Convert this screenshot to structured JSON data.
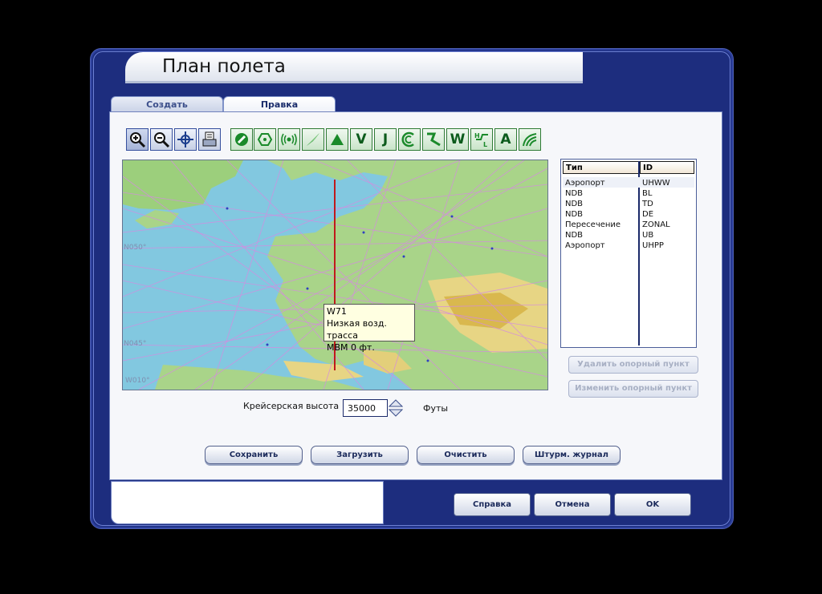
{
  "window": {
    "title": "План полета"
  },
  "tabs": [
    {
      "label": "Создать"
    },
    {
      "label": "Правка"
    }
  ],
  "toolbar": {
    "map_tools": [
      "zoom-in-icon",
      "zoom-out-icon",
      "center-icon",
      "print-icon"
    ],
    "filters": [
      {
        "icon": "airport-filter-icon",
        "label": ""
      },
      {
        "icon": "vor-filter-icon",
        "label": ""
      },
      {
        "icon": "ndb-filter-icon",
        "label": ""
      },
      {
        "icon": "ils-filter-icon",
        "label": ""
      },
      {
        "icon": "intersection-filter-icon",
        "label": ""
      },
      {
        "icon": "victor-airways-icon",
        "label": "V"
      },
      {
        "icon": "jet-airways-icon",
        "label": "J"
      },
      {
        "icon": "airspace-icon",
        "label": ""
      },
      {
        "icon": "route-icon",
        "label": ""
      },
      {
        "icon": "waypoint-filter-icon",
        "label": "W"
      },
      {
        "icon": "hl-airways-icon",
        "label": ""
      },
      {
        "icon": "text-labels-icon",
        "label": "A"
      },
      {
        "icon": "terrain-icon",
        "label": ""
      }
    ]
  },
  "map": {
    "lat_labels": [
      "N050°",
      "N045°",
      "W010°"
    ],
    "tooltip": {
      "line1": "W71",
      "line2": "Низкая возд. трасса",
      "line3": "МВМ 0 фт."
    }
  },
  "waypoints": {
    "headers": {
      "type": "Тип",
      "id": "ID"
    },
    "rows": [
      {
        "type": "Аэропорт",
        "id": "UHWW"
      },
      {
        "type": "NDB",
        "id": "BL"
      },
      {
        "type": "NDB",
        "id": "TD"
      },
      {
        "type": "NDB",
        "id": "DE"
      },
      {
        "type": "Пересечение",
        "id": "ZONAL"
      },
      {
        "type": "NDB",
        "id": "UB"
      },
      {
        "type": "Аэропорт",
        "id": "UHPP"
      }
    ]
  },
  "side_buttons": {
    "delete": "Удалить опорный пункт",
    "edit": "Изменить опорный пункт"
  },
  "cruise": {
    "label": "Крейсерская высота",
    "value": "35000",
    "unit": "Футы"
  },
  "actions": {
    "save": "Сохранить",
    "load": "Загрузить",
    "clear": "Очистить",
    "navlog": "Штурм. журнал"
  },
  "dialog": {
    "help": "Справка",
    "cancel": "Отмена",
    "ok": "OK"
  }
}
